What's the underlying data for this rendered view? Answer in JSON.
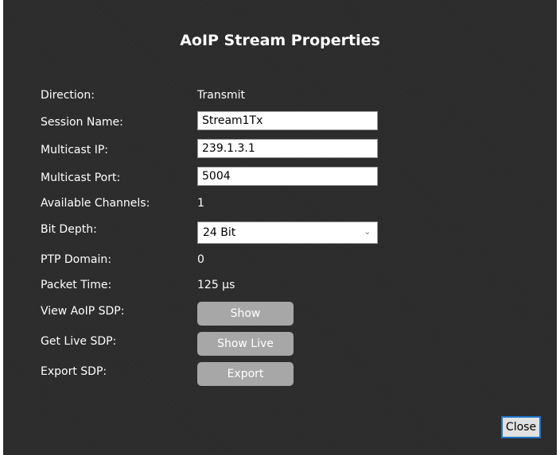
{
  "dialog": {
    "title": "AoIP Stream Properties",
    "close_label": "Close"
  },
  "fields": {
    "direction": {
      "label": "Direction:",
      "value": "Transmit"
    },
    "session_name": {
      "label": "Session Name:",
      "value": "Stream1Tx"
    },
    "multicast_ip": {
      "label": "Multicast IP:",
      "value": "239.1.3.1"
    },
    "multicast_port": {
      "label": "Multicast Port:",
      "value": "5004"
    },
    "available_channels": {
      "label": "Available Channels:",
      "value": "1"
    },
    "bit_depth": {
      "label": "Bit Depth:",
      "selected": "24 Bit"
    },
    "ptp_domain": {
      "label": "PTP Domain:",
      "value": "0"
    },
    "packet_time": {
      "label": "Packet Time:",
      "value": "125 µs"
    },
    "view_aoip_sdp": {
      "label": "View AoIP SDP:",
      "button": "Show"
    },
    "get_live_sdp": {
      "label": "Get Live SDP:",
      "button": "Show Live"
    },
    "export_sdp": {
      "label": "Export SDP:",
      "button": "Export"
    }
  },
  "icons": {
    "dropdown": "chevron-down-icon"
  },
  "colors": {
    "background": "#2b2b2b",
    "button": "#a7a7a7",
    "close_border": "#1e74c9"
  }
}
